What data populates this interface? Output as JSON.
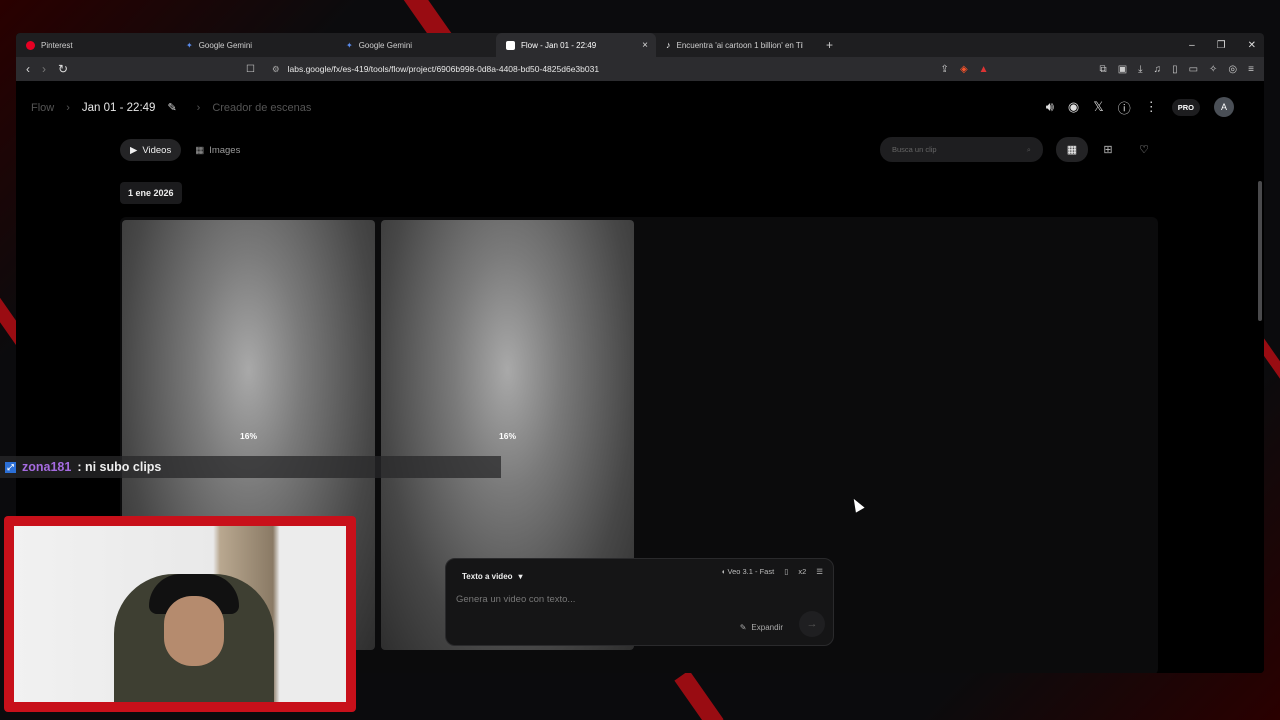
{
  "browser": {
    "tabs": [
      {
        "title": "Pinterest",
        "favicon_color": "#e60023",
        "active": false
      },
      {
        "title": "Google Gemini",
        "favicon_color": "#5b8def",
        "active": false
      },
      {
        "title": "Google Gemini",
        "favicon_color": "#5b8def",
        "active": false
      },
      {
        "title": "Flow - Jan 01 - 22:49",
        "favicon_color": "#ffffff",
        "active": true
      },
      {
        "title": "Encuentra 'ai cartoon 1 billion' en Tik",
        "favicon_color": "#ffffff",
        "active": false
      }
    ],
    "new_tab": "+",
    "close_tab": "×",
    "url": "labs.google/fx/es-419/tools/flow/project/6906b998-0d8a-4408-bd50-4825d6e3b031",
    "window_controls": {
      "minimize": "–",
      "restore": "❐",
      "close": "✕"
    }
  },
  "flow": {
    "breadcrumb": {
      "root": "Flow",
      "project": "Jan 01 - 22:49",
      "section": "Creador de escenas"
    },
    "header": {
      "pro_badge": "PRO",
      "avatar_initial": "A"
    },
    "tabs": {
      "videos": "Videos",
      "images": "Images"
    },
    "search": {
      "placeholder": "Busca un clip"
    },
    "date_group": "1 ene 2026",
    "clips": [
      {
        "progress_label": "16%",
        "progress": 0.16
      },
      {
        "progress_label": "16%",
        "progress": 0.16
      }
    ],
    "composer": {
      "mode": "Texto a video",
      "model": "Veo 3.1 - Fast",
      "count": "x2",
      "placeholder": "Genera un video con texto...",
      "expand": "Expandir"
    }
  },
  "stream": {
    "chat": {
      "user": "zona181",
      "message": ": ni subo clips"
    }
  },
  "colors": {
    "accent_red": "#c8101a",
    "chat_user": "#a56be0"
  }
}
